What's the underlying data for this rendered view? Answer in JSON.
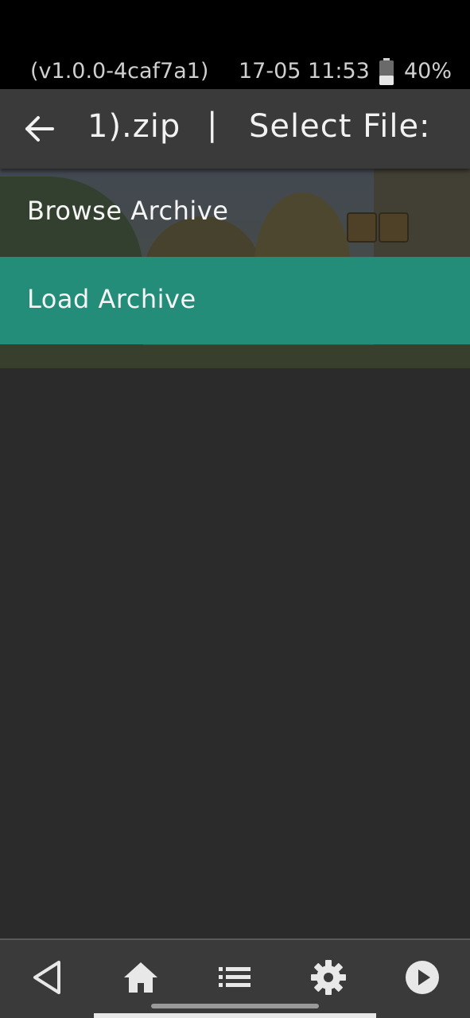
{
  "status_bar": {
    "version": "(v1.0.0-4caf7a1)",
    "datetime": "17-05 11:53",
    "battery_percent": "40%",
    "battery_level": 0.4
  },
  "title_bar": {
    "archive_name": "1).zip",
    "separator": "|",
    "prompt": "Select File:"
  },
  "menu": {
    "items": [
      {
        "label": "Browse Archive",
        "selected": false
      },
      {
        "label": "Load Archive",
        "selected": true
      }
    ]
  },
  "colors": {
    "selection": "#238d79",
    "background": "#2b2b2b",
    "bars": "#3a3a3a"
  },
  "bottom_nav": {
    "icons": [
      "back-triangle-icon",
      "home-icon",
      "list-icon",
      "gear-icon",
      "play-icon"
    ]
  }
}
